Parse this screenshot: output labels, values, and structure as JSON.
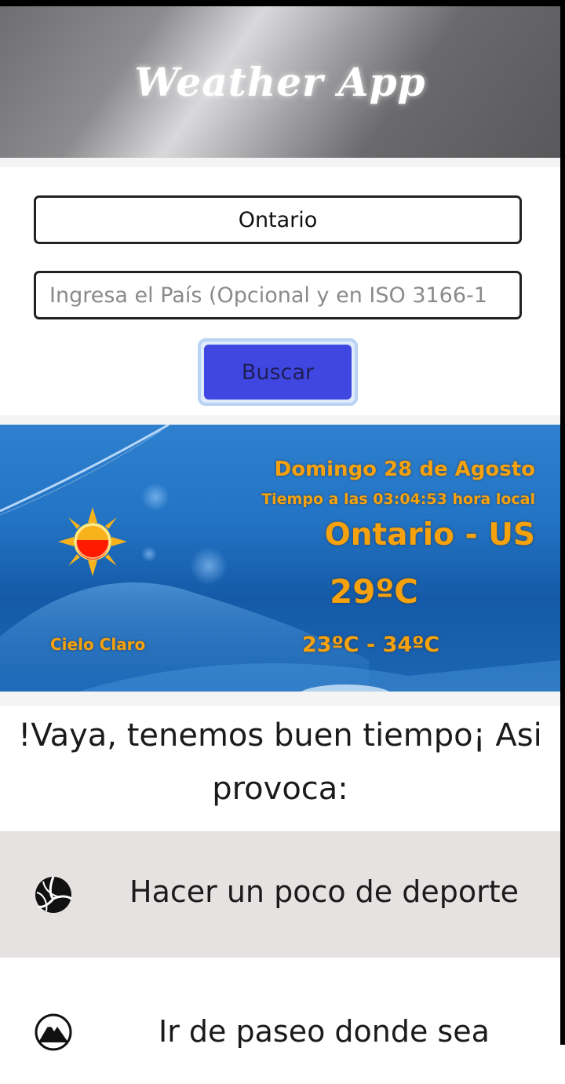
{
  "header": {
    "title": "Weather App"
  },
  "search": {
    "city_value": "Ontario",
    "country_placeholder": "Ingresa el País (Opcional y en ISO 3166-1",
    "button_label": "Buscar"
  },
  "weather": {
    "date": "Domingo 28 de Agosto",
    "time_text": "Tiempo a las 03:04:53 hora local",
    "place": "Ontario - US",
    "temperature": "29ºC",
    "range": "23ºC - 34ºC",
    "description": "Cielo Claro",
    "icon": "sun-icon",
    "text_color": "#f5a20e"
  },
  "advice": {
    "text": "!Vaya, tenemos buen tiempo¡ Asi provoca:"
  },
  "activities": [
    {
      "icon": "volleyball-icon",
      "label": "Hacer un poco de deporte"
    },
    {
      "icon": "mountain-icon",
      "label": "Ir de paseo donde sea"
    }
  ],
  "colors": {
    "button": "#4047e0",
    "button_focus_ring": "#b9d3f5",
    "activity_highlight": "#e6e2e1"
  }
}
